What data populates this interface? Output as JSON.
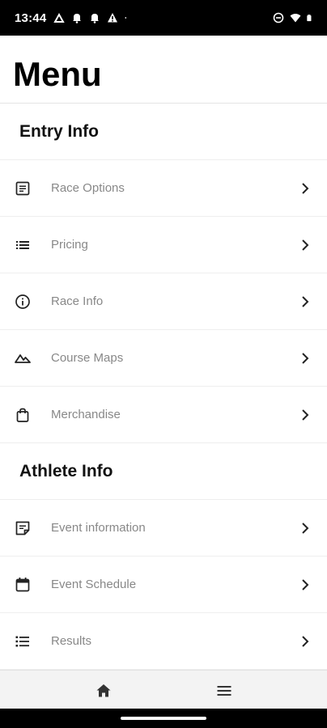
{
  "status_bar": {
    "time": "13:44",
    "left_icons": [
      "cloud-upload-icon",
      "bell-icon",
      "bell-icon",
      "warning-icon",
      "dot-icon"
    ],
    "right_icons": [
      "do-not-disturb-icon",
      "wifi-icon",
      "battery-icon"
    ]
  },
  "header": {
    "title": "Menu"
  },
  "sections": [
    {
      "title": "Entry Info",
      "items": [
        {
          "label": "Race Options",
          "icon": "document-icon"
        },
        {
          "label": "Pricing",
          "icon": "list-icon"
        },
        {
          "label": "Race Info",
          "icon": "info-icon"
        },
        {
          "label": "Course Maps",
          "icon": "terrain-icon"
        },
        {
          "label": "Merchandise",
          "icon": "shopping-bag-icon"
        }
      ]
    },
    {
      "title": "Athlete Info",
      "items": [
        {
          "label": "Event information",
          "icon": "note-icon"
        },
        {
          "label": "Event Schedule",
          "icon": "calendar-icon"
        },
        {
          "label": "Results",
          "icon": "numbered-list-icon"
        }
      ]
    }
  ],
  "bottom_nav": {
    "items": [
      "home-icon",
      "menu-icon"
    ]
  },
  "colors": {
    "label": "#888888",
    "section_title": "#111111",
    "divider": "#eeeeee",
    "nav_background": "#f3f3f3",
    "status_bar": "#000000"
  }
}
